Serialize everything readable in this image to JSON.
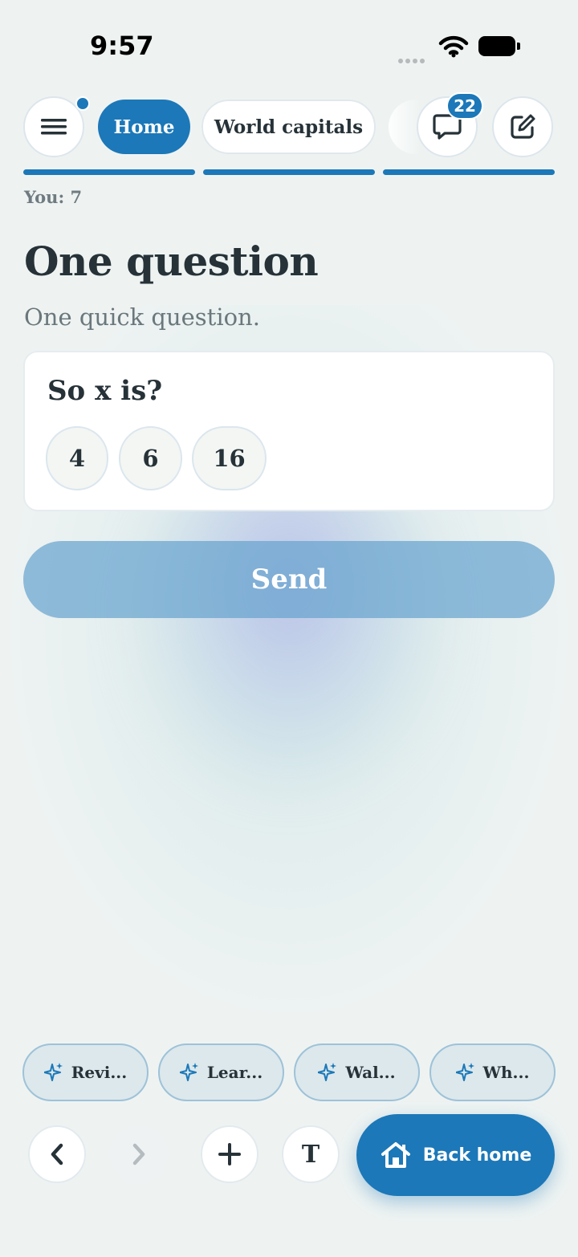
{
  "status_bar": {
    "time": "9:57"
  },
  "nav": {
    "menu_icon": "hamburger-icon",
    "tabs": [
      {
        "label": "Home",
        "active": true
      },
      {
        "label": "World capitals",
        "active": false
      }
    ],
    "chat_badge": "22",
    "chat_icon": "chat-bubble-icon",
    "edit_icon": "edit-icon"
  },
  "progress": {
    "segments_total": 3,
    "segments_filled": 3
  },
  "score": "You: 7",
  "page": {
    "title": "One question",
    "subtitle": "One quick question."
  },
  "question_card": {
    "question": "So x is?",
    "options": [
      "4",
      "6",
      "16"
    ]
  },
  "send_label": "Send",
  "suggestions": [
    "Revi...",
    "Lear...",
    "Wal...",
    "Wh..."
  ],
  "toolbar": {
    "text_label": "T",
    "back_home_label": "Back home"
  },
  "colors": {
    "accent": "#1c78b8",
    "background": "#eef3f2",
    "text": "#263238"
  }
}
